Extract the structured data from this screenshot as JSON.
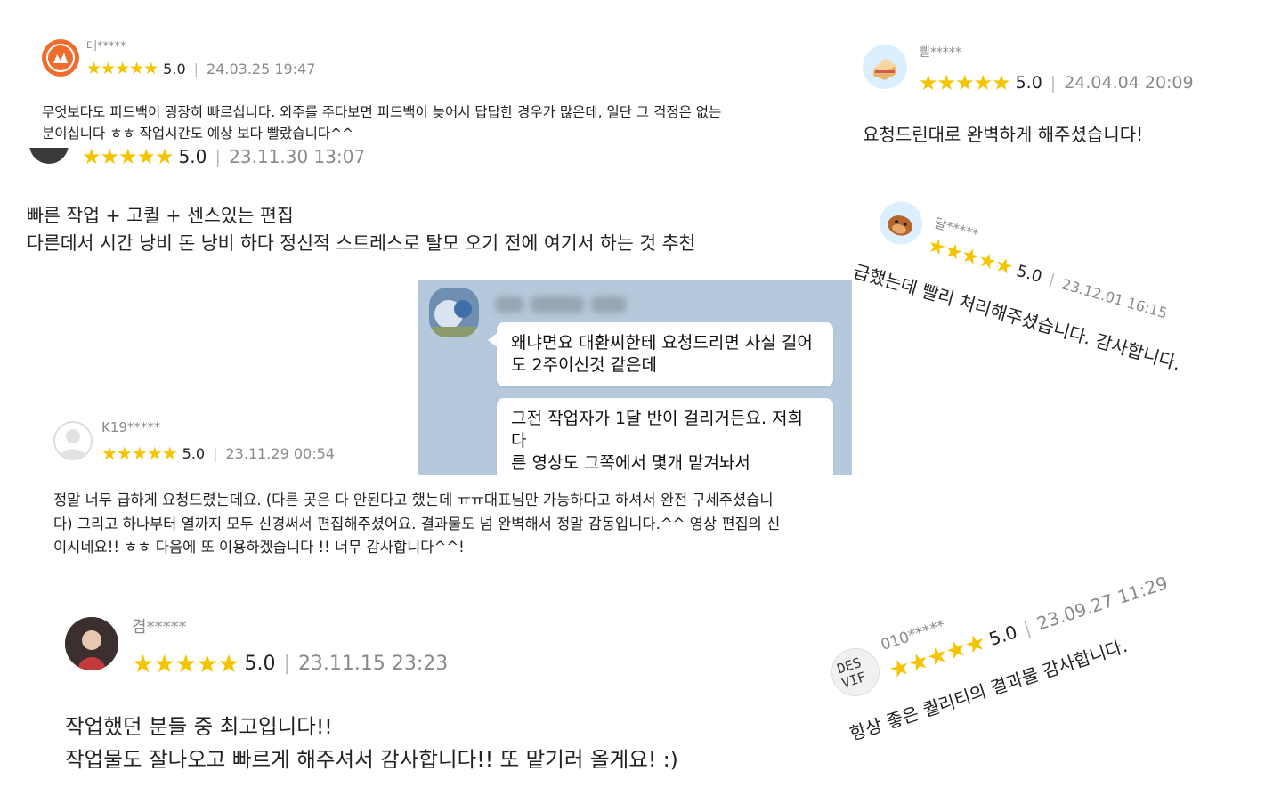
{
  "reviews": [
    {
      "user": "대*****",
      "rating": "5.0",
      "date": "24.03.25 19:47",
      "text": "무엇보다도 피드백이 굉장히 빠르십니다. 외주를 주다보면 피드백이 늦어서 답답한 경우가 많은데, 일단 그 걱정은 없는\n분이십니다 ㅎㅎ 작업시간도 예상 보다 빨랐습니다^^"
    },
    {
      "rating": "5.0",
      "date": "23.11.30 13:07",
      "text": "빠른 작업 + 고퀄 + 센스있는 편집\n다른데서 시간 낭비 돈 낭비 하다 정신적 스트레스로 탈모 오기 전에 여기서 하는 것 추천"
    },
    {
      "user": "K19*****",
      "rating": "5.0",
      "date": "23.11.29 00:54",
      "text": "정말  너무 급하게 요청드렸는데요. (다른 곳은 다 안된다고 했는데 ㅠㅠ대표님만 가능하다고 하셔서 완전 구세주셨습니\n다)  그리고  하나부터 열까지 모두 신경써서 편집해주셨어요. 결과물도 넘 완벽해서 정말 감동입니다.^^ 영상 편집의 신\n이시네요!! ㅎㅎ 다음에 또 이용하겠습니다 !! 너무 감사합니다^^!"
    },
    {
      "user": "겸*****",
      "rating": "5.0",
      "date": "23.11.15 23:23",
      "text": "작업했던 분들 중 최고입니다!!\n작업물도 잘나오고 빠르게 해주셔서 감사합니다!! 또 맡기러 올게요! :)"
    },
    {
      "user": "삘*****",
      "rating": "5.0",
      "date": "24.04.04 20:09",
      "text": "요청드린대로 완벽하게 해주셨습니다!"
    },
    {
      "user": "달*****",
      "rating": "5.0",
      "date": "23.12.01 16:15",
      "text": "급했는데 빨리 처리해주셨습니다. 감사합니다."
    },
    {
      "user": "010*****",
      "rating": "5.0",
      "date": "23.09.27 11:29",
      "text": "항상 좋은 퀄리티의 결과물 감사합니다.",
      "avatar_text": "DES\nVIF"
    }
  ],
  "chat": {
    "messages": [
      "왜냐면요 대환씨한테 요청드리면 사실 길어\n도 2주이신것 같은데",
      "그전 작업자가 1달 반이 걸리거든요. 저희 다\n른 영상도 그쪽에서 몇개 맡겨놔서"
    ]
  },
  "stars": "★★★★★",
  "colors": {
    "star": "#f5c400",
    "chat_bg": "#b6c9dc",
    "text": "#222222",
    "muted": "#8a8a8a"
  }
}
